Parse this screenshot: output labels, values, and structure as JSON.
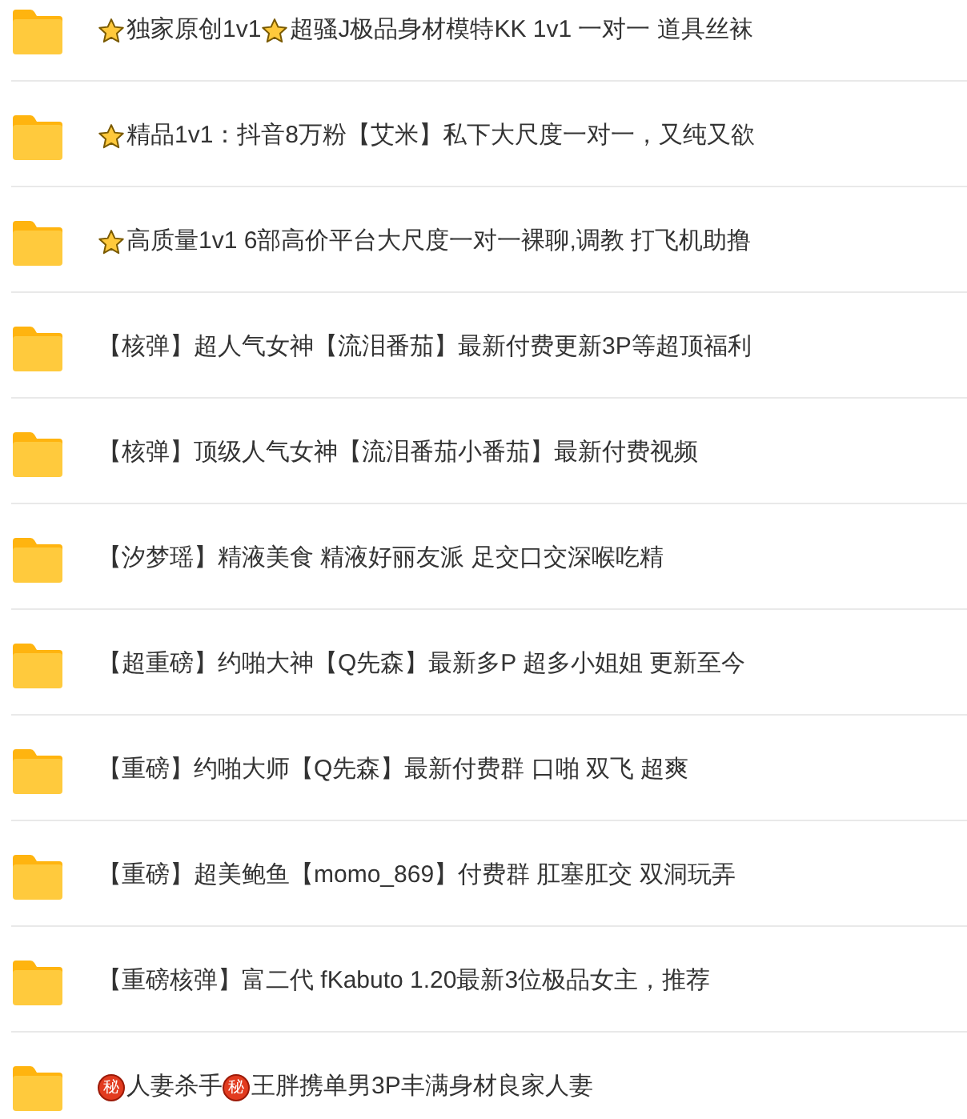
{
  "folders": [
    {
      "name": [
        {
          "kind": "star"
        },
        {
          "kind": "text",
          "text": "独家原创1v1"
        },
        {
          "kind": "star"
        },
        {
          "kind": "text",
          "text": "超骚J极品身材模特KK 1v1 一对一 道具丝袜"
        }
      ]
    },
    {
      "name": [
        {
          "kind": "star"
        },
        {
          "kind": "text",
          "text": "精品1v1：抖音8万粉【艾米】私下大尺度一对一，又纯又欲"
        }
      ]
    },
    {
      "name": [
        {
          "kind": "star"
        },
        {
          "kind": "text",
          "text": "高质量1v1 6部高价平台大尺度一对一裸聊,调教 打飞机助撸"
        }
      ]
    },
    {
      "name": [
        {
          "kind": "text",
          "text": "【核弹】超人气女神【流泪番茄】最新付费更新3P等超顶福利"
        }
      ]
    },
    {
      "name": [
        {
          "kind": "text",
          "text": "【核弹】顶级人气女神【流泪番茄小番茄】最新付费视频"
        }
      ]
    },
    {
      "name": [
        {
          "kind": "text",
          "text": "【汐梦瑶】精液美食 精液好丽友派 足交口交深喉吃精"
        }
      ]
    },
    {
      "name": [
        {
          "kind": "text",
          "text": "【超重磅】约啪大神【Q先森】最新多P 超多小姐姐 更新至今"
        }
      ]
    },
    {
      "name": [
        {
          "kind": "text",
          "text": "【重磅】约啪大师【Q先森】最新付费群 口啪 双飞 超爽"
        }
      ]
    },
    {
      "name": [
        {
          "kind": "text",
          "text": "【重磅】超美鲍鱼【momo_869】付费群 肛塞肛交 双洞玩弄"
        }
      ]
    },
    {
      "name": [
        {
          "kind": "text",
          "text": "【重磅核弹】富二代 fKabuto 1.20最新3位极品女主，推荐"
        }
      ]
    },
    {
      "name": [
        {
          "kind": "badge",
          "text": "秘"
        },
        {
          "kind": "text",
          "text": "人妻杀手"
        },
        {
          "kind": "badge",
          "text": "秘"
        },
        {
          "kind": "text",
          "text": "王胖携单男3P丰满身材良家人妻"
        }
      ]
    }
  ]
}
